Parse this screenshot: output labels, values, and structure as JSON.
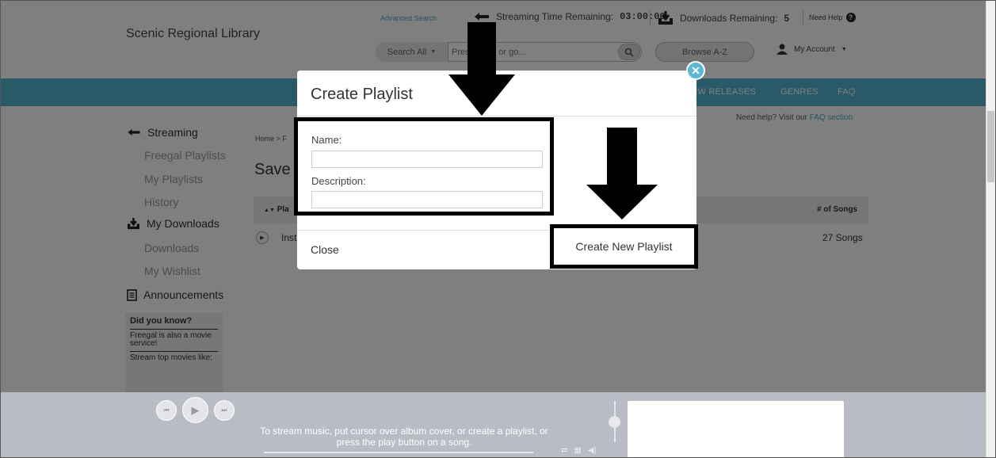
{
  "header": {
    "library_name": "Scenic Regional Library",
    "advanced_search": "Advanced Search",
    "streaming_label": "Streaming Time Remaining:",
    "streaming_value": "03:00:00",
    "downloads_label": "Downloads Remaining:",
    "downloads_value": "5",
    "need_help": "Need Help",
    "search_scope": "Search All",
    "search_placeholder": "Press enter or go...",
    "browse": "Browse A-Z",
    "my_account": "My Account"
  },
  "nav": {
    "items": [
      "EW RELEASES",
      "GENRES",
      "FAQ"
    ]
  },
  "help_line": {
    "text": "Need help? Visit our ",
    "link": "FAQ section"
  },
  "sidebar": {
    "streaming": "Streaming",
    "freegal_playlists": "Freegal Playlists",
    "my_playlists": "My Playlists",
    "history": "History",
    "my_downloads": "My Downloads",
    "downloads": "Downloads",
    "my_wishlist": "My Wishlist",
    "announcements": "Announcements",
    "did_you_know": {
      "title": "Did you know?",
      "line1": "Freegal is also a movie service!",
      "line2": "Stream top movies like:"
    }
  },
  "page": {
    "breadcrumb": "Home > F",
    "title": "Save",
    "col_name": "Pla",
    "col_songs": "# of Songs",
    "row_name": "Inst",
    "row_songs": "27 Songs"
  },
  "modal": {
    "title": "Create Playlist",
    "name_label": "Name:",
    "name_value": "",
    "description_label": "Description:",
    "description_value": "",
    "close": "Close",
    "create": "Create New Playlist"
  },
  "player": {
    "message": "To stream music, put cursor over album cover, or create a playlist, or press the play button on a song."
  },
  "colors": {
    "nav_blue": "#54b5d0",
    "player_gray": "#b9bcc4"
  }
}
